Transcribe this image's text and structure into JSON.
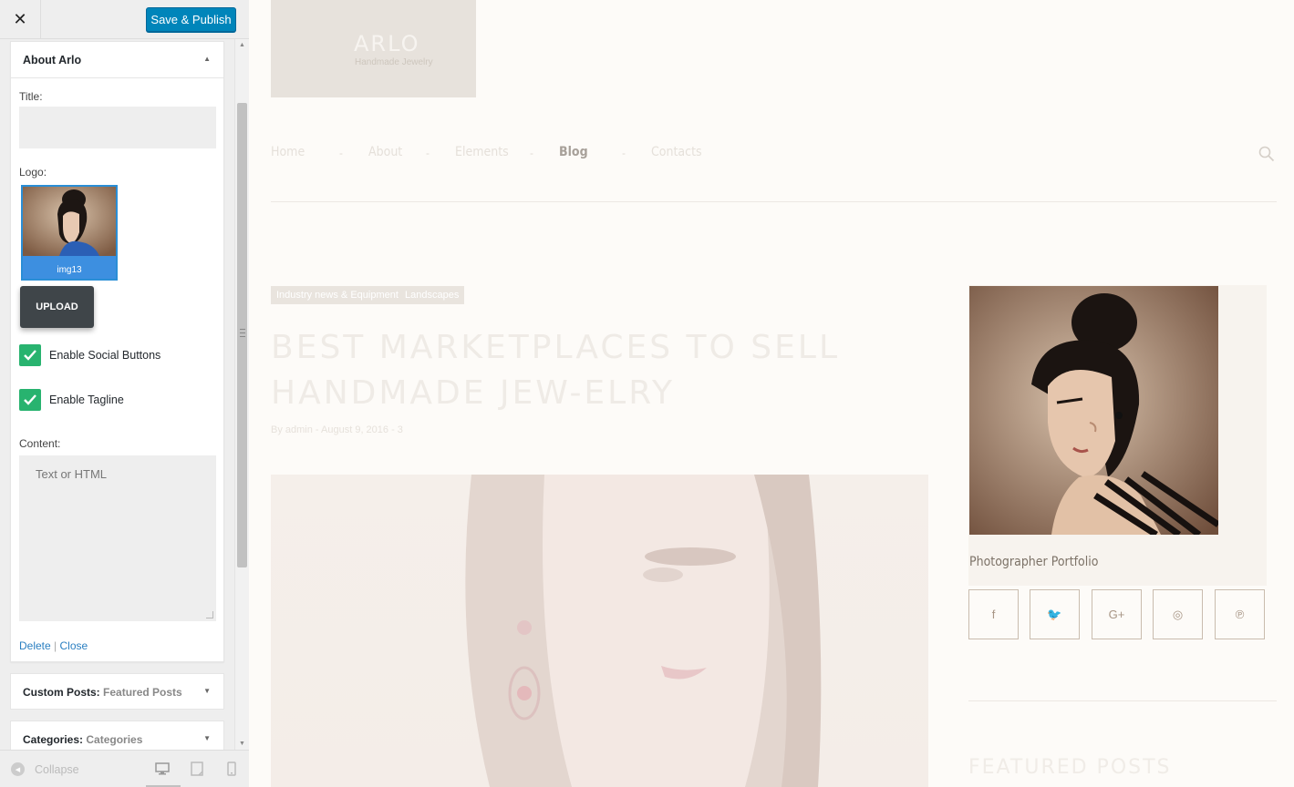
{
  "customizer": {
    "close_icon": "close-icon",
    "publish_label": "Save & Publish",
    "widget": {
      "title": "About Arlo",
      "title_label": "Title:",
      "title_value": "",
      "logo_label": "Logo:",
      "logo_caption": "img13",
      "upload_label": "UPLOAD",
      "checkbox_social": {
        "label": "Enable Social Buttons",
        "checked": true
      },
      "checkbox_tagline": {
        "label": "Enable Tagline",
        "checked": true
      },
      "content_label": "Content:",
      "content_placeholder": "Text or HTML",
      "delete_label": "Delete",
      "link_separator": "|",
      "close_label": "Close"
    },
    "collapsed_widgets": [
      {
        "name": "Custom Posts:",
        "value": "Featured Posts"
      },
      {
        "name": "Categories:",
        "value": "Categories"
      }
    ],
    "footer": {
      "collapse_label": "Collapse",
      "devices": [
        "desktop-icon",
        "tablet-icon",
        "mobile-icon"
      ],
      "active_device": "desktop-icon"
    },
    "accent_color": "#0085ba",
    "check_color": "#28b36f"
  },
  "site": {
    "name": "ARLO",
    "tagline": "Handmade Jewelry",
    "nav": [
      {
        "label": "Home",
        "active": false
      },
      {
        "label": "About",
        "active": false
      },
      {
        "label": "Elements",
        "active": false
      },
      {
        "label": "Blog",
        "active": true
      },
      {
        "label": "Contacts",
        "active": false
      }
    ],
    "nav_separator": "-",
    "post": {
      "tags": [
        "Industry news & Equipment",
        "Landscapes"
      ],
      "title": "BEST MARKETPLACES TO SELL HANDMADE JEW-ELRY",
      "meta": "By admin - August 9, 2016 - 3"
    },
    "sidebar": {
      "caption": "Photographer Portfolio",
      "social_icons": [
        "facebook-icon",
        "twitter-icon",
        "google-plus-icon",
        "instagram-icon",
        "pinterest-icon"
      ],
      "social_glyphs": [
        "f",
        "🐦",
        "G+",
        "◎",
        "℗"
      ],
      "featured_heading": "FEATURED POSTS"
    }
  }
}
